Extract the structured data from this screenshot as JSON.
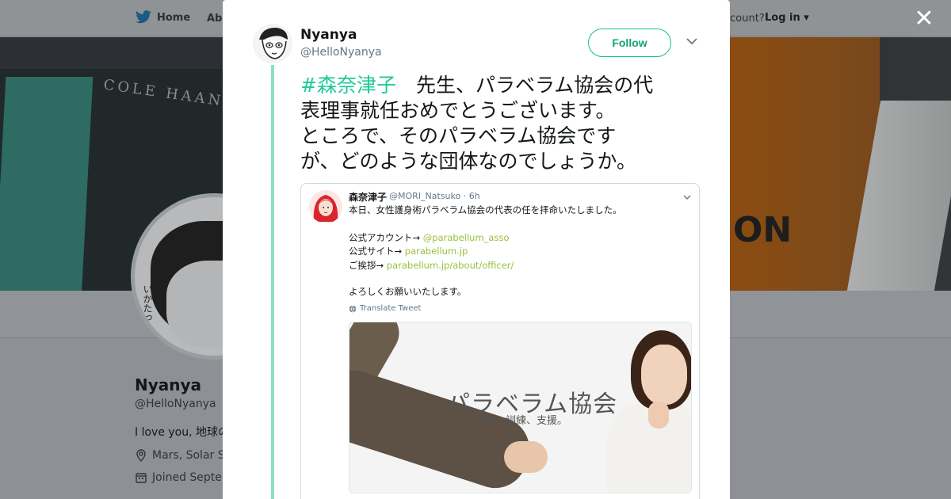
{
  "nav": {
    "home_label": "Home",
    "about_label": "Abo",
    "account_text": "ccount?",
    "login_label": "Log in"
  },
  "banner": {
    "text_left": "COLE HAAN",
    "text_right": "ON"
  },
  "profile": {
    "name": "Nyanya",
    "handle": "@HelloNyanya",
    "bio": "I love you, 地球の",
    "location": "Mars, Solar Sy",
    "joined": "Joined Septem",
    "avatar_text": "いかたっ"
  },
  "tweet": {
    "author_name": "Nyanya",
    "author_handle": "@HelloNyanya",
    "follow_label": "Follow",
    "hashtag": "#森奈津子",
    "text_lines": [
      "　先生、パラベラム協会の代",
      "表理事就任おめでとうございます。",
      "ところで、そのパラベラム協会です",
      "が、どのような団体なのでしょうか。"
    ]
  },
  "quoted": {
    "name": "森奈津子",
    "meta": "@MORI_Natsuko · 6h",
    "line1": "本日、女性護身術パラベラム協会の代表の任を拝命いたしました。",
    "account_prefix": "公式アカウント→ ",
    "account_link": "@parabellum_asso",
    "site_prefix": "公式サイト→ ",
    "site_link": "parabellum.jp",
    "greeting_prefix": "ご挨拶→ ",
    "greeting_link": "parabellum.jp/about/officer/",
    "closing": "よろしくお願いいたします。",
    "translate_label": "Translate Tweet",
    "image_title": "パラベラム協会",
    "image_subtitle": "研究、訓練、支援。"
  },
  "colors": {
    "accent": "#17bf8e",
    "hashtag": "#20c997",
    "thread_line": "#8ae0c2",
    "quoted_link": "#9bbf3d"
  },
  "icons": {
    "twitter_bird": "twitter-bird-icon",
    "close": "close-icon",
    "caret": "chevron-down-icon",
    "location": "location-pin-icon",
    "calendar": "calendar-icon",
    "globe": "globe-icon"
  }
}
